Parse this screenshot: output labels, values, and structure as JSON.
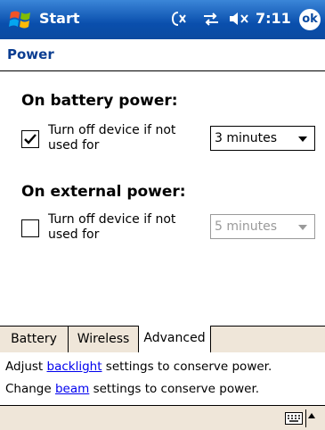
{
  "title_bar": {
    "start_label": "Start",
    "clock": "7:11",
    "ok_label": "ok",
    "icons": [
      "no-connectivity-icon",
      "sync-arrows-icon",
      "speaker-muted-icon"
    ]
  },
  "page": {
    "title": "Power"
  },
  "battery": {
    "heading": "On battery power:",
    "checkbox_checked": true,
    "option_label": "Turn off device if not used for",
    "dropdown_value": "3 minutes",
    "dropdown_enabled": true
  },
  "external": {
    "heading": "On external power:",
    "checkbox_checked": false,
    "option_label": "Turn off device if not used for",
    "dropdown_value": "5 minutes",
    "dropdown_enabled": false
  },
  "tabs": [
    {
      "label": "Battery",
      "active": false
    },
    {
      "label": "Wireless",
      "active": false
    },
    {
      "label": "Advanced",
      "active": true
    }
  ],
  "help": {
    "line1_pre": "Adjust ",
    "line1_link": "backlight",
    "line1_post": " settings to conserve power.",
    "line2_pre": "Change ",
    "line2_link": "beam",
    "line2_post": " settings to conserve power."
  },
  "colors": {
    "title_bar": "#0b4aa0",
    "accent_text": "#0a3d91",
    "link": "#0000ee",
    "disabled": "#9a9a9a",
    "tab_strip": "#efe6d9"
  }
}
